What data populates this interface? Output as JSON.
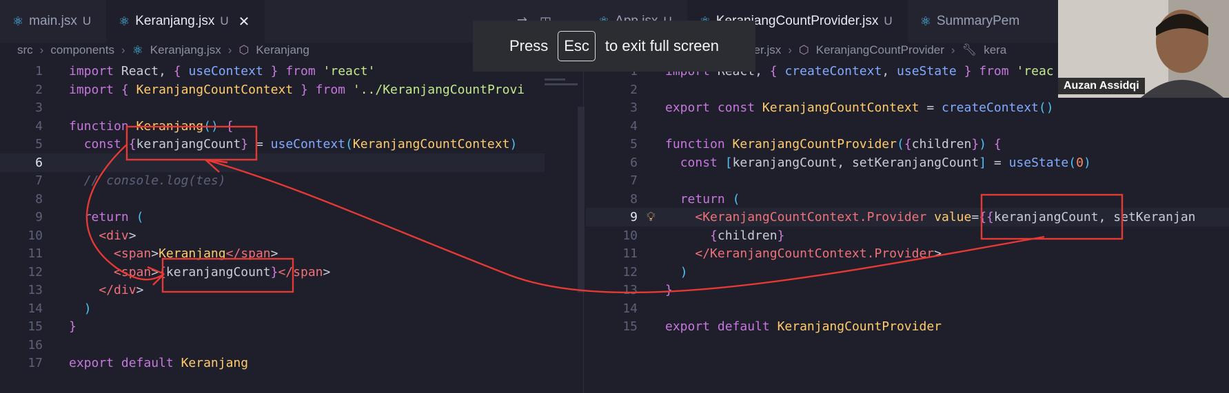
{
  "left_tabs": [
    {
      "name": "main.jsx",
      "badge": "U",
      "active": false
    },
    {
      "name": "Keranjang.jsx",
      "badge": "U",
      "active": true,
      "close": "✕"
    }
  ],
  "right_tabs": [
    {
      "name": "App.jsx",
      "badge": "U"
    },
    {
      "name": "KeranjangCountProvider.jsx",
      "badge": "U"
    },
    {
      "name": "SummaryPem",
      "badge": ""
    }
  ],
  "left_breadcrumb": [
    "src",
    "components",
    "Keranjang.jsx",
    "Keranjang"
  ],
  "right_breadcrumb": [
    "CountProvider.jsx",
    "KeranjangCountProvider",
    "kera"
  ],
  "toast": {
    "before": "Press",
    "key": "Esc",
    "after": "to exit full screen"
  },
  "webcam": {
    "name": "Auzan Assidqi"
  },
  "left_code": [
    {
      "n": "1",
      "t": "import React, { useContext } from 'react'"
    },
    {
      "n": "2",
      "t": "import { KeranjangCountContext } from '../KeranjangCountProvi"
    },
    {
      "n": "3",
      "t": ""
    },
    {
      "n": "4",
      "t": "function Keranjang() {"
    },
    {
      "n": "5",
      "t": "  const {keranjangCount} = useContext(KeranjangCountContext)"
    },
    {
      "n": "6",
      "t": ""
    },
    {
      "n": "7",
      "t": "  // console.log(tes)"
    },
    {
      "n": "8",
      "t": ""
    },
    {
      "n": "9",
      "t": "  return ("
    },
    {
      "n": "10",
      "t": "    <div>"
    },
    {
      "n": "11",
      "t": "      <span>Keranjang</span>"
    },
    {
      "n": "12",
      "t": "      <span>{keranjangCount}</span>"
    },
    {
      "n": "13",
      "t": "    </div>"
    },
    {
      "n": "14",
      "t": "  )"
    },
    {
      "n": "15",
      "t": "}"
    },
    {
      "n": "16",
      "t": ""
    },
    {
      "n": "17",
      "t": "export default Keranjang"
    }
  ],
  "right_code": [
    {
      "n": "1",
      "t": "import React, { createContext, useState } from 'reac"
    },
    {
      "n": "2",
      "t": ""
    },
    {
      "n": "3",
      "t": "export const KeranjangCountContext = createContext()"
    },
    {
      "n": "4",
      "t": ""
    },
    {
      "n": "5",
      "t": "function KeranjangCountProvider({children}) {"
    },
    {
      "n": "6",
      "t": "  const [keranjangCount, setKeranjangCount] = useState(0)"
    },
    {
      "n": "7",
      "t": ""
    },
    {
      "n": "8",
      "t": "  return ("
    },
    {
      "n": "9",
      "t": "    <KeranjangCountContext.Provider value={{keranjangCount, setKeranjan"
    },
    {
      "n": "10",
      "t": "      {children}"
    },
    {
      "n": "11",
      "t": "    </KeranjangCountContext.Provider>"
    },
    {
      "n": "12",
      "t": "  )"
    },
    {
      "n": "13",
      "t": "}"
    },
    {
      "n": "14",
      "t": ""
    },
    {
      "n": "15",
      "t": "export default KeranjangCountProvider"
    }
  ],
  "colors": {
    "annotation": "#e53935",
    "background": "#1e1f2b"
  },
  "icons": [
    "react-icon",
    "compare-icon",
    "split-editor-icon",
    "more-icon",
    "symbol-icon",
    "wrench-icon",
    "lightbulb-icon"
  ]
}
